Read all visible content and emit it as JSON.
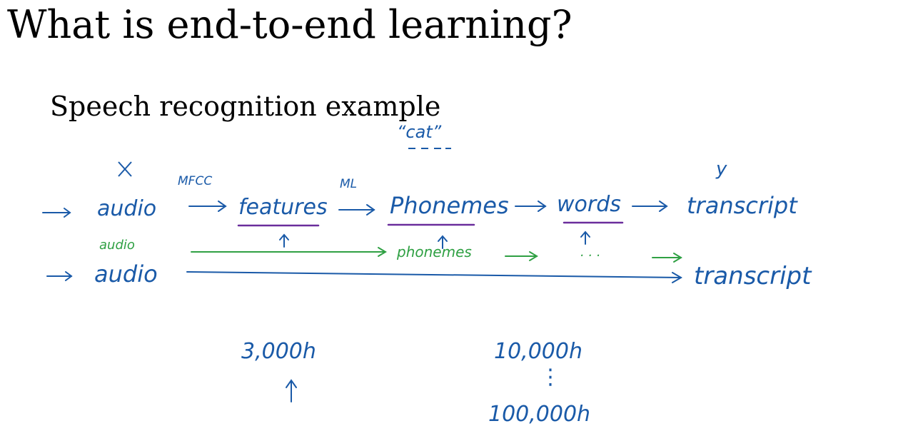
{
  "slide": {
    "title": "What is end-to-end learning?",
    "subtitle": "Speech recognition example"
  },
  "pipeline": {
    "input_label": "X",
    "output_label": "y",
    "audio": "audio",
    "mfcc": "MFCC",
    "features": "features",
    "ml": "ML",
    "phonemes": "Phonemes",
    "cat": "“cat”",
    "words": "words",
    "transcript": "transcript"
  },
  "middle_path": {
    "audio": "audio",
    "phonemes": "phonemes",
    "ellipsis": "· · ·"
  },
  "end_to_end": {
    "audio": "audio",
    "transcript": "transcript"
  },
  "data_sizes": {
    "small": "3,000h",
    "medium": "10,000h",
    "dots": "⋮",
    "large": "100,000h"
  },
  "colors": {
    "ink_blue": "#1a5aa8",
    "ink_purple": "#6a2d9c",
    "ink_green": "#2fa043"
  }
}
